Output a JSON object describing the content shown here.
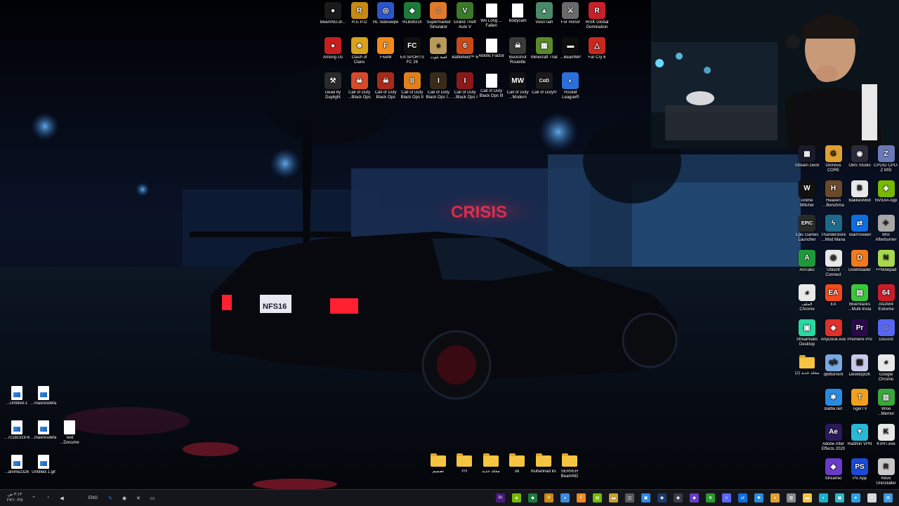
{
  "colors": {
    "taskbar_bg": "#14161c",
    "folder": "#f5c542",
    "neon_red": "#ff2e4d",
    "sky": "#0b1430"
  },
  "desktop": {
    "top_grid": [
      {
        "label": "BeamNG.dr...",
        "icon": "beamng-icon",
        "color": "#1a1a1a",
        "glyph": "●"
      },
      {
        "label": "R.E.P.O",
        "icon": "repo-icon",
        "color": "#c98a14",
        "glyph": "R"
      },
      {
        "label": "RL Sideswipe",
        "icon": "rocket-league-sideswipe-icon",
        "color": "#2b55c8",
        "glyph": "◎"
      },
      {
        "label": "RLBotGUI",
        "icon": "rlbot-icon",
        "color": "#1e7a3b",
        "glyph": "◆"
      },
      {
        "label": "Supermarket Simulator",
        "icon": "supermarket-icon",
        "color": "#e07a2b",
        "glyph": "☺"
      },
      {
        "label": "Grand Theft Auto V",
        "icon": "gta-icon",
        "color": "#3b7a2a",
        "glyph": "V"
      },
      {
        "label": "Wo Long ... Fallen",
        "icon": "file-icon",
        "color": "#ffffff",
        "glyph": ""
      },
      {
        "label": "Bodycam",
        "icon": "file-icon",
        "color": "#ffffff",
        "glyph": ""
      },
      {
        "label": "VoidTrain",
        "icon": "voidtrain-icon",
        "color": "#4a8a6a",
        "glyph": "▲"
      },
      {
        "label": "For Honor",
        "icon": "for-honor-icon",
        "color": "#6a6a6a",
        "glyph": "⚔"
      },
      {
        "label": "RISK Global Domination",
        "icon": "risk-icon",
        "color": "#c8202a",
        "glyph": "R"
      },
      {
        "label": "Among Us",
        "icon": "among-us-icon",
        "color": "#c81e1e",
        "glyph": "●"
      },
      {
        "label": "Clash of Clans",
        "icon": "clash-icon",
        "color": "#d8a21c",
        "glyph": "☻"
      },
      {
        "label": "FiveM",
        "icon": "fivem-icon",
        "color": "#f08a1c",
        "glyph": "F"
      },
      {
        "label": "EA SPORTS FC 26",
        "icon": "ea-fc-icon",
        "color": "#101010",
        "glyph": "FC"
      },
      {
        "label": "لعبة بلوت",
        "icon": "baloot-icon",
        "color": "#b89a5a",
        "glyph": "♠"
      },
      {
        "label": "Battlefield™ 6",
        "icon": "battlefield-icon",
        "color": "#c84a1c",
        "glyph": "6"
      },
      {
        "label": "Abiotic Factor",
        "icon": "file-icon",
        "color": "#ffffff",
        "glyph": ""
      },
      {
        "label": "Buckshot Roulette",
        "icon": "buckshot-icon",
        "color": "#3a3a3a",
        "glyph": "☠"
      },
      {
        "label": "Minecraft Trial",
        "icon": "minecraft-icon",
        "color": "#5a8a2a",
        "glyph": "▦"
      },
      {
        "label": "...BeamMP",
        "icon": "beammp-icon",
        "color": "#0e0e0e",
        "glyph": "▬"
      },
      {
        "label": "Far Cry 6",
        "icon": "far-cry-icon",
        "color": "#c8281e",
        "glyph": "△"
      },
      {
        "label": "Dead by Daylight",
        "icon": "dbd-icon",
        "color": "#2a2a2a",
        "glyph": "⚒"
      },
      {
        "label": "Call of Duty ...Black Ops",
        "icon": "cod-icon",
        "color": "#d84a2a",
        "glyph": "☠"
      },
      {
        "label": "Call of Duty Black Ops",
        "icon": "cod-icon",
        "color": "#aa2a1a",
        "glyph": "☠"
      },
      {
        "label": "Call of Duty Black Ops II",
        "icon": "cod-icon",
        "color": "#e0801c",
        "glyph": "II"
      },
      {
        "label": "Call of Duty Black Ops I...",
        "icon": "cod-icon",
        "color": "#3a2a1a",
        "glyph": "I"
      },
      {
        "label": "Call of Duty ...Black Ops I",
        "icon": "cod-icon",
        "color": "#8a1a1a",
        "glyph": "I"
      },
      {
        "label": "Call of Duty Black Ops III",
        "icon": "file-icon",
        "color": "#ffffff",
        "glyph": ""
      },
      {
        "label": "Call of Duty ...Modern",
        "icon": "cod-mw-icon",
        "color": "#121212",
        "glyph": "MW"
      },
      {
        "label": "Call of Duty®",
        "icon": "cod-icon",
        "color": "#1a1a1a",
        "glyph": "CoD"
      },
      {
        "label": "Rocket League®",
        "icon": "rocket-league-icon",
        "color": "#2a70d8",
        "glyph": "◐"
      }
    ],
    "right_grid": [
      {
        "label": "Stream Deck",
        "icon": "stream-deck-icon",
        "color": "#1a1a2a",
        "glyph": "▦"
      },
      {
        "label": "Glorious CORE",
        "icon": "glorious-icon",
        "color": "#e0a030",
        "glyph": "G"
      },
      {
        "label": "OBS Studio",
        "icon": "obs-icon",
        "color": "#2a2a3a",
        "glyph": "◉"
      },
      {
        "label": "CPUID CPU-Z MSI",
        "icon": "cpuz-icon",
        "color": "#6a7ab8",
        "glyph": "Z"
      },
      {
        "label": "Anime Witcher",
        "icon": "anime-witcher-icon",
        "color": "#111111",
        "glyph": "W"
      },
      {
        "label": "Heaven ...Benchma",
        "icon": "heaven-icon",
        "color": "#6a4a2a",
        "glyph": "H"
      },
      {
        "label": "BakkesMod",
        "icon": "bakkesmod-icon",
        "color": "#e8e8e8",
        "glyph": "B"
      },
      {
        "label": "NVIDIA App",
        "icon": "nvidia-icon",
        "color": "#76b900",
        "glyph": "◈"
      },
      {
        "label": "Epic Games Launcher",
        "icon": "epic-icon",
        "color": "#2a2a2a",
        "glyph": "EPIC"
      },
      {
        "label": "Thunderstore ...Mod Mana",
        "icon": "thunderstore-icon",
        "color": "#1f6a8a",
        "glyph": "ϟ"
      },
      {
        "label": "TeamViewer",
        "icon": "teamviewer-icon",
        "color": "#0e6ee0",
        "glyph": "⇄"
      },
      {
        "label": "MSI Afterburner",
        "icon": "afterburner-icon",
        "color": "#a8a8a8",
        "glyph": "✈"
      },
      {
        "label": "AniTaku",
        "icon": "anitaku-icon",
        "color": "#1f9a3a",
        "glyph": "A"
      },
      {
        "label": "Ubisoft Connect",
        "icon": "ubisoft-icon",
        "color": "#e8e8e8",
        "glyph": "◎"
      },
      {
        "label": "Downloader",
        "icon": "downloader-icon",
        "color": "#f07a1c",
        "glyph": "D"
      },
      {
        "label": "++Notepad",
        "icon": "notepad-plus-icon",
        "color": "#a8d850",
        "glyph": "N"
      },
      {
        "label": "الملف Chrome",
        "icon": "chrome-icon",
        "color": "#e8e8e8",
        "glyph": "◕"
      },
      {
        "label": "EA",
        "icon": "ea-icon",
        "color": "#f04a1c",
        "glyph": "EA"
      },
      {
        "label": "BlueStacks ...Multi-Insta",
        "icon": "bluestacks-icon",
        "color": "#3ac83a",
        "glyph": "▤"
      },
      {
        "label": "AIDA64 Extreme",
        "icon": "aida64-icon",
        "color": "#c81e2a",
        "glyph": "64"
      },
      {
        "label": "Streamlabs Desktop",
        "icon": "streamlabs-icon",
        "color": "#2ad8a0",
        "glyph": "▣"
      },
      {
        "label": "AnyDesk.exe",
        "icon": "anydesk-icon",
        "color": "#e0302a",
        "glyph": "◆"
      },
      {
        "label": "Premiere Pro",
        "icon": "premiere-icon",
        "color": "#2a0a4a",
        "glyph": "Pr"
      },
      {
        "label": "Discord",
        "icon": "discord-icon",
        "color": "#5865f2",
        "glyph": "☺"
      },
      {
        "label": "مجلد جديد (2)",
        "icon": "folder-icon",
        "color": "#f5c542",
        "glyph": "",
        "folder": true
      },
      {
        "label": "qBittorrent",
        "icon": "qbittorrent-icon",
        "color": "#7aa8e0",
        "glyph": "qb"
      },
      {
        "label": "DesktopOK",
        "icon": "desktopok-icon",
        "color": "#c8c8e8",
        "glyph": "▦"
      },
      {
        "label": "Google Chrome",
        "icon": "chrome-icon",
        "color": "#e8e8e8",
        "glyph": "◕"
      },
      {
        "label": "",
        "icon": "",
        "color": "",
        "glyph": "",
        "empty": true
      },
      {
        "label": "Battle.net",
        "icon": "battlenet-icon",
        "color": "#2a8ae0",
        "glyph": "✱"
      },
      {
        "label": "TigerTV",
        "icon": "tigertv-icon",
        "color": "#f0a01c",
        "glyph": "T"
      },
      {
        "label": "Wise ...Memor",
        "icon": "wise-memory-icon",
        "color": "#3aa83a",
        "glyph": "▥"
      },
      {
        "label": "",
        "icon": "",
        "color": "",
        "glyph": "",
        "empty": true
      },
      {
        "label": "Adobe After Effects 2020",
        "icon": "after-effects-icon",
        "color": "#2a1a5a",
        "glyph": "Ae"
      },
      {
        "label": "Radmin VPN",
        "icon": "radmin-icon",
        "color": "#2ab8d8",
        "glyph": "▼"
      },
      {
        "label": "KVRT.exe",
        "icon": "kvrt-icon",
        "color": "#e8e8e8",
        "glyph": "K"
      },
      {
        "label": "",
        "icon": "",
        "color": "",
        "glyph": "",
        "empty": true
      },
      {
        "label": "Streamio",
        "icon": "stremio-icon",
        "color": "#6a3ac8",
        "glyph": "◆"
      },
      {
        "label": "PS App",
        "icon": "ps-app-icon",
        "color": "#1a4ad8",
        "glyph": "PS"
      },
      {
        "label": "Revo Uninstaller",
        "icon": "revo-icon",
        "color": "#c8c8c8",
        "glyph": "R"
      }
    ],
    "left_files": [
      {
        "label": "...Untitled-1",
        "type": "img"
      },
      {
        "label": "...maxresdefa",
        "type": "img"
      },
      {
        "label": "...7c18c319-6",
        "type": "img"
      },
      {
        "label": "...maxresdefa",
        "type": "img"
      },
      {
        "label": "Text ...Docume",
        "type": "txt"
      },
      {
        "label": "...anime2326",
        "type": "img"
      },
      {
        "label": "Untitled-1.gif",
        "type": "img"
      }
    ],
    "bottom_folders": [
      {
        "label": "تصميم"
      },
      {
        "label": "!!!!!"
      },
      {
        "label": "مجلد جديد"
      },
      {
        "label": "ok"
      },
      {
        "label": "muhannad ks"
      },
      {
        "label": "SERVER BeamNG"
      }
    ]
  },
  "wallpaper": {
    "plate_text": "NFS16",
    "neon_sign": "CRISIS"
  },
  "taskbar": {
    "time": "٣:١٣ ص",
    "date": "٢٧/١٠/٢٥",
    "language": "ENG",
    "tray_icons": [
      {
        "icon": "up-arrow-icon",
        "glyph": "⌃",
        "color": "#d8d8d8"
      },
      {
        "icon": "wifi-icon",
        "glyph": "◔",
        "color": "#d8d8d8"
      },
      {
        "icon": "volume-icon",
        "glyph": "◀",
        "color": "#d8d8d8"
      },
      {
        "icon": "pen-icon",
        "glyph": "✎",
        "color": "#3a8ae0"
      },
      {
        "icon": "steam-icon",
        "glyph": "◉",
        "color": "#d8d8d8"
      },
      {
        "icon": "close-x-icon",
        "glyph": "✕",
        "color": "#d8d8d8"
      },
      {
        "icon": "monitor-icon",
        "glyph": "▭",
        "color": "#d8d8d8"
      }
    ],
    "pinned": [
      {
        "icon": "premiere-icon",
        "glyph": "Pr",
        "color": "#4a1a7a"
      },
      {
        "icon": "nvidia-icon",
        "glyph": "◈",
        "color": "#76b900"
      },
      {
        "icon": "rlbot-icon",
        "glyph": "◆",
        "color": "#1e7a3b"
      },
      {
        "icon": "repo-icon",
        "glyph": "R",
        "color": "#c98a14"
      },
      {
        "icon": "chrome-icon",
        "glyph": "◕",
        "color": "#3a8ae0"
      },
      {
        "icon": "fivem-icon",
        "glyph": "F",
        "color": "#f08a1c"
      },
      {
        "icon": "geforce-icon",
        "glyph": "▤",
        "color": "#76b900"
      },
      {
        "icon": "beammp-icon",
        "glyph": "▬",
        "color": "#c8a030"
      },
      {
        "icon": "kvrt-icon",
        "glyph": "◫",
        "color": "#5a5a5a"
      },
      {
        "icon": "photos-icon",
        "glyph": "▣",
        "color": "#2a8ae0"
      },
      {
        "icon": "steam-icon",
        "glyph": "◉",
        "color": "#1a3a6a"
      },
      {
        "icon": "obs-icon",
        "glyph": "◉",
        "color": "#3a3a4a"
      },
      {
        "icon": "stremio-icon",
        "glyph": "◆",
        "color": "#6a3ac8"
      },
      {
        "icon": "xbox-icon",
        "glyph": "⊗",
        "color": "#2a9a2a"
      },
      {
        "icon": "discord-icon",
        "glyph": "☺",
        "color": "#5865f2"
      },
      {
        "icon": "teamviewer-icon",
        "glyph": "⇄",
        "color": "#0e6ee0"
      },
      {
        "icon": "battlenet-icon",
        "glyph": "✱",
        "color": "#2a8ae0"
      },
      {
        "icon": "chrome-icon",
        "glyph": "◕",
        "color": "#e0a030"
      },
      {
        "icon": "task-view-icon",
        "glyph": "▥",
        "color": "#8a8a8a"
      },
      {
        "icon": "file-explorer-icon",
        "glyph": "▬",
        "color": "#f5c542"
      },
      {
        "icon": "edge-icon",
        "glyph": "◐",
        "color": "#1ab0c8"
      },
      {
        "icon": "photos-icon",
        "glyph": "▣",
        "color": "#2ab8c8"
      },
      {
        "icon": "telegram-icon",
        "glyph": "➤",
        "color": "#2aa0e0"
      },
      {
        "icon": "search-icon",
        "glyph": "⌕",
        "color": "#d8d8d8"
      },
      {
        "icon": "windows-start-icon",
        "glyph": "⊞",
        "color": "#3a9ae0"
      }
    ]
  }
}
